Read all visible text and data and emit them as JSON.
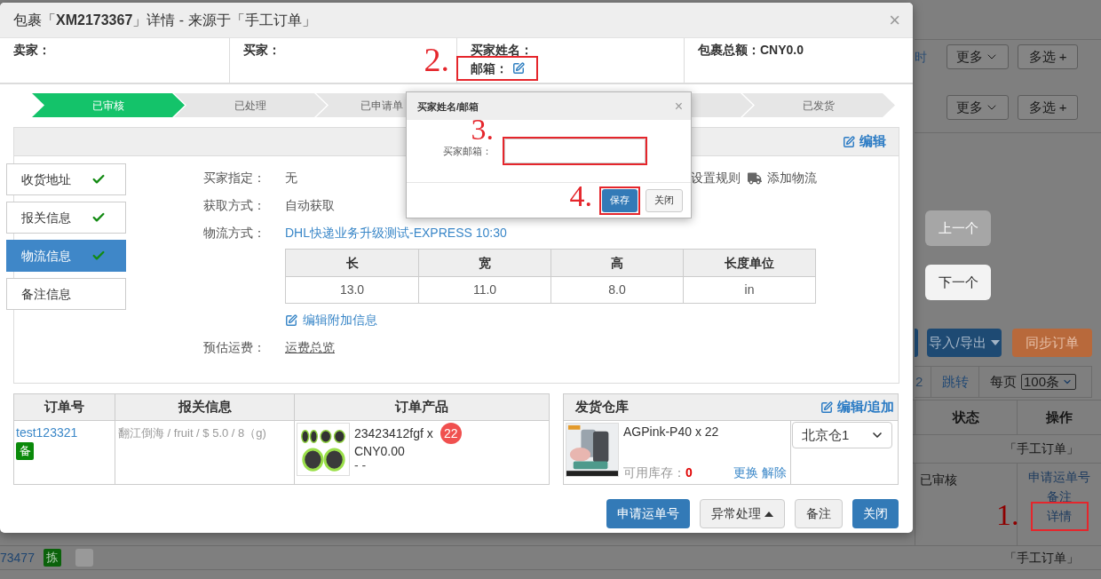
{
  "background": {
    "toolbar_rows": [
      {
        "link": "时",
        "buttons": [
          {
            "label": "更多",
            "menu": true
          },
          {
            "label": "多选 +",
            "menu": false
          }
        ]
      },
      {
        "buttons": [
          {
            "label": "更多",
            "menu": true
          },
          {
            "label": "多选 +",
            "menu": false
          }
        ]
      }
    ],
    "nav_buttons": [
      {
        "label": "上一个",
        "disabled": true
      },
      {
        "label": "下一个",
        "disabled": false
      }
    ],
    "action_buttons": [
      {
        "label": "导入/导出",
        "kind": "primary",
        "menu": true
      },
      {
        "label": "同步订单",
        "kind": "warning",
        "menu": false
      }
    ],
    "pagination": {
      "pages": "2",
      "jump": "跳转",
      "per_page_label": "每页",
      "per_page": "100条"
    },
    "table": {
      "columns": [
        "状态",
        "操作"
      ],
      "rows": [
        {
          "kind": "group",
          "source": "「手工订单」"
        },
        {
          "kind": "order",
          "status": "已审核",
          "actions": [
            {
              "label": "申请运单号",
              "highlighted": false
            },
            {
              "label": "备注",
              "highlighted": false
            },
            {
              "label": "详情",
              "highlighted": true,
              "annotation": "1."
            }
          ]
        },
        {
          "kind": "group",
          "order_no": "73477",
          "badge": "拣",
          "source": "「手工订单」"
        }
      ]
    }
  },
  "modal": {
    "title": "包裹「**XM2173367**」详情 - 来源于「手工订单」",
    "close": "×",
    "info": [
      {
        "kind": "plain",
        "label": "卖家："
      },
      {
        "kind": "plain",
        "label": "买家："
      },
      {
        "kind": "buyer",
        "label": "买家姓名：",
        "email_label": "邮箱：",
        "highlighted": true,
        "annotation": "2."
      },
      {
        "kind": "plain",
        "label": "包裹总额：",
        "value": "CNY0.0"
      }
    ],
    "steps": [
      {
        "label": "已审核",
        "active": true
      },
      {
        "label": "已处理",
        "active": false
      },
      {
        "label": "已申请单",
        "active": false
      },
      {
        "active": false
      },
      {
        "label": "已发货",
        "active": false
      }
    ],
    "panel": {
      "edit_link": "编辑",
      "tabs": [
        {
          "label": "收货地址",
          "complete": true,
          "selected": false
        },
        {
          "label": "报关信息",
          "complete": true,
          "selected": false
        },
        {
          "label": "物流信息",
          "complete": true,
          "selected": true
        },
        {
          "label": "备注信息",
          "complete": false,
          "selected": false
        }
      ],
      "tools": [
        {
          "kind": "rules",
          "label": "设置规则"
        },
        {
          "kind": "truck",
          "label": "添加物流"
        }
      ],
      "fields": [
        {
          "kind": "text",
          "label": "买家指定：",
          "value": "无"
        },
        {
          "kind": "text",
          "label": "获取方式：",
          "value": "自动获取"
        },
        {
          "kind": "link",
          "label": "物流方式：",
          "value": "DHL快递业务升级测试-EXPRESS 10:30"
        }
      ],
      "dimensions": {
        "columns": [
          "长",
          "宽",
          "高",
          "长度单位"
        ],
        "rows": [
          [
            "13.0",
            "11.0",
            "8.0",
            "in"
          ]
        ]
      },
      "extra_link": "编辑附加信息",
      "estimate": {
        "label": "预估运费：",
        "value": "运费总览"
      }
    },
    "orders": {
      "columns": [
        "订单号",
        "报关信息",
        "订单产品"
      ],
      "rows": [
        {
          "order_no": "test123321",
          "badge": "备",
          "customs": "翻江倒海 / fruit / $ 5.0 / 8（g)",
          "sku": "23423412fgf x",
          "qty": "22",
          "price": "CNY0.00",
          "note": "- -"
        }
      ]
    },
    "warehouse": {
      "title": "发货仓库",
      "edit_link": "编辑/追加",
      "items": [
        {
          "name": "AGPink-P40 x 22",
          "stock_label": "可用库存：",
          "stock": "0",
          "links": [
            "更换",
            "解除"
          ],
          "warehouse": "北京仓1"
        }
      ]
    },
    "buttons": [
      {
        "label": "申请运单号",
        "kind": "primary",
        "menu": false
      },
      {
        "label": "异常处理",
        "kind": "default",
        "menu": true
      },
      {
        "label": "备注",
        "kind": "default",
        "menu": false
      },
      {
        "label": "关闭",
        "kind": "primary",
        "menu": false
      }
    ],
    "email_dialog": {
      "title": "买家姓名/邮箱",
      "close": "×",
      "field": {
        "label": "买家邮箱：",
        "highlighted": true,
        "annotation": "3."
      },
      "buttons": [
        {
          "label": "保存",
          "kind": "primary",
          "highlighted": true,
          "annotation": "4."
        },
        {
          "label": "关闭",
          "kind": "default",
          "highlighted": false
        }
      ]
    }
  }
}
